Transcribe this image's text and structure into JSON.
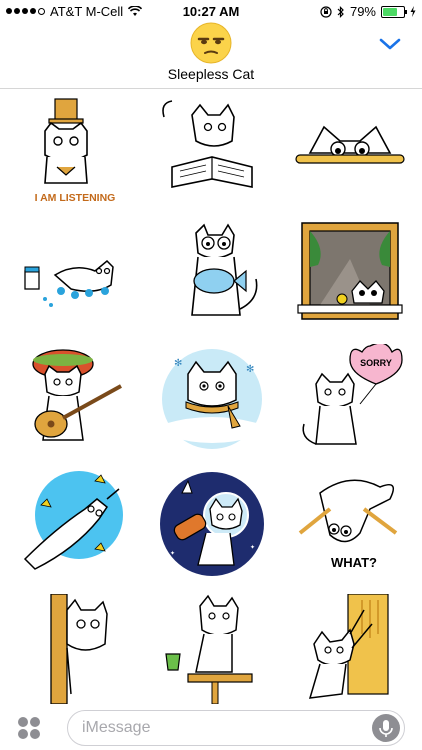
{
  "status_bar": {
    "carrier": "AT&T M-Cell",
    "time": "10:27 AM",
    "battery_percent": "79%",
    "battery_level": 0.79,
    "icons": [
      "signal-dots-icon",
      "wifi-icon",
      "rotation-lock-icon",
      "bluetooth-icon",
      "battery-icon",
      "charging-bolt-icon"
    ]
  },
  "header": {
    "app_icon": "sleepy-emoji-icon",
    "title": "Sleepless Cat",
    "collapse_icon": "chevron-down-icon"
  },
  "stickers": [
    {
      "name": "sticker-listening-cat",
      "caption": "I AM LISTENING"
    },
    {
      "name": "sticker-reading-cat",
      "caption": ""
    },
    {
      "name": "sticker-peeking-cat",
      "caption": ""
    },
    {
      "name": "sticker-paint-cat",
      "caption": ""
    },
    {
      "name": "sticker-fish-cat",
      "caption": ""
    },
    {
      "name": "sticker-window-cat",
      "caption": ""
    },
    {
      "name": "sticker-guitar-cat",
      "caption": ""
    },
    {
      "name": "sticker-winter-cat",
      "caption": ""
    },
    {
      "name": "sticker-sorry-cat",
      "caption": "SORRY"
    },
    {
      "name": "sticker-flying-cat",
      "caption": ""
    },
    {
      "name": "sticker-space-cat",
      "caption": ""
    },
    {
      "name": "sticker-what-cat",
      "caption": "WHAT?"
    },
    {
      "name": "sticker-door-cat",
      "caption": ""
    },
    {
      "name": "sticker-table-cat",
      "caption": ""
    },
    {
      "name": "sticker-scratch-cat",
      "caption": ""
    }
  ],
  "composer": {
    "apps_icon": "app-drawer-icon",
    "placeholder": "iMessage",
    "mic_icon": "microphone-icon"
  },
  "colors": {
    "accent": "#1a73e8",
    "sticker_yellow": "#f0c24b",
    "sticker_blue": "#4cc3f0",
    "emoji_yellow": "#fbd34a"
  }
}
